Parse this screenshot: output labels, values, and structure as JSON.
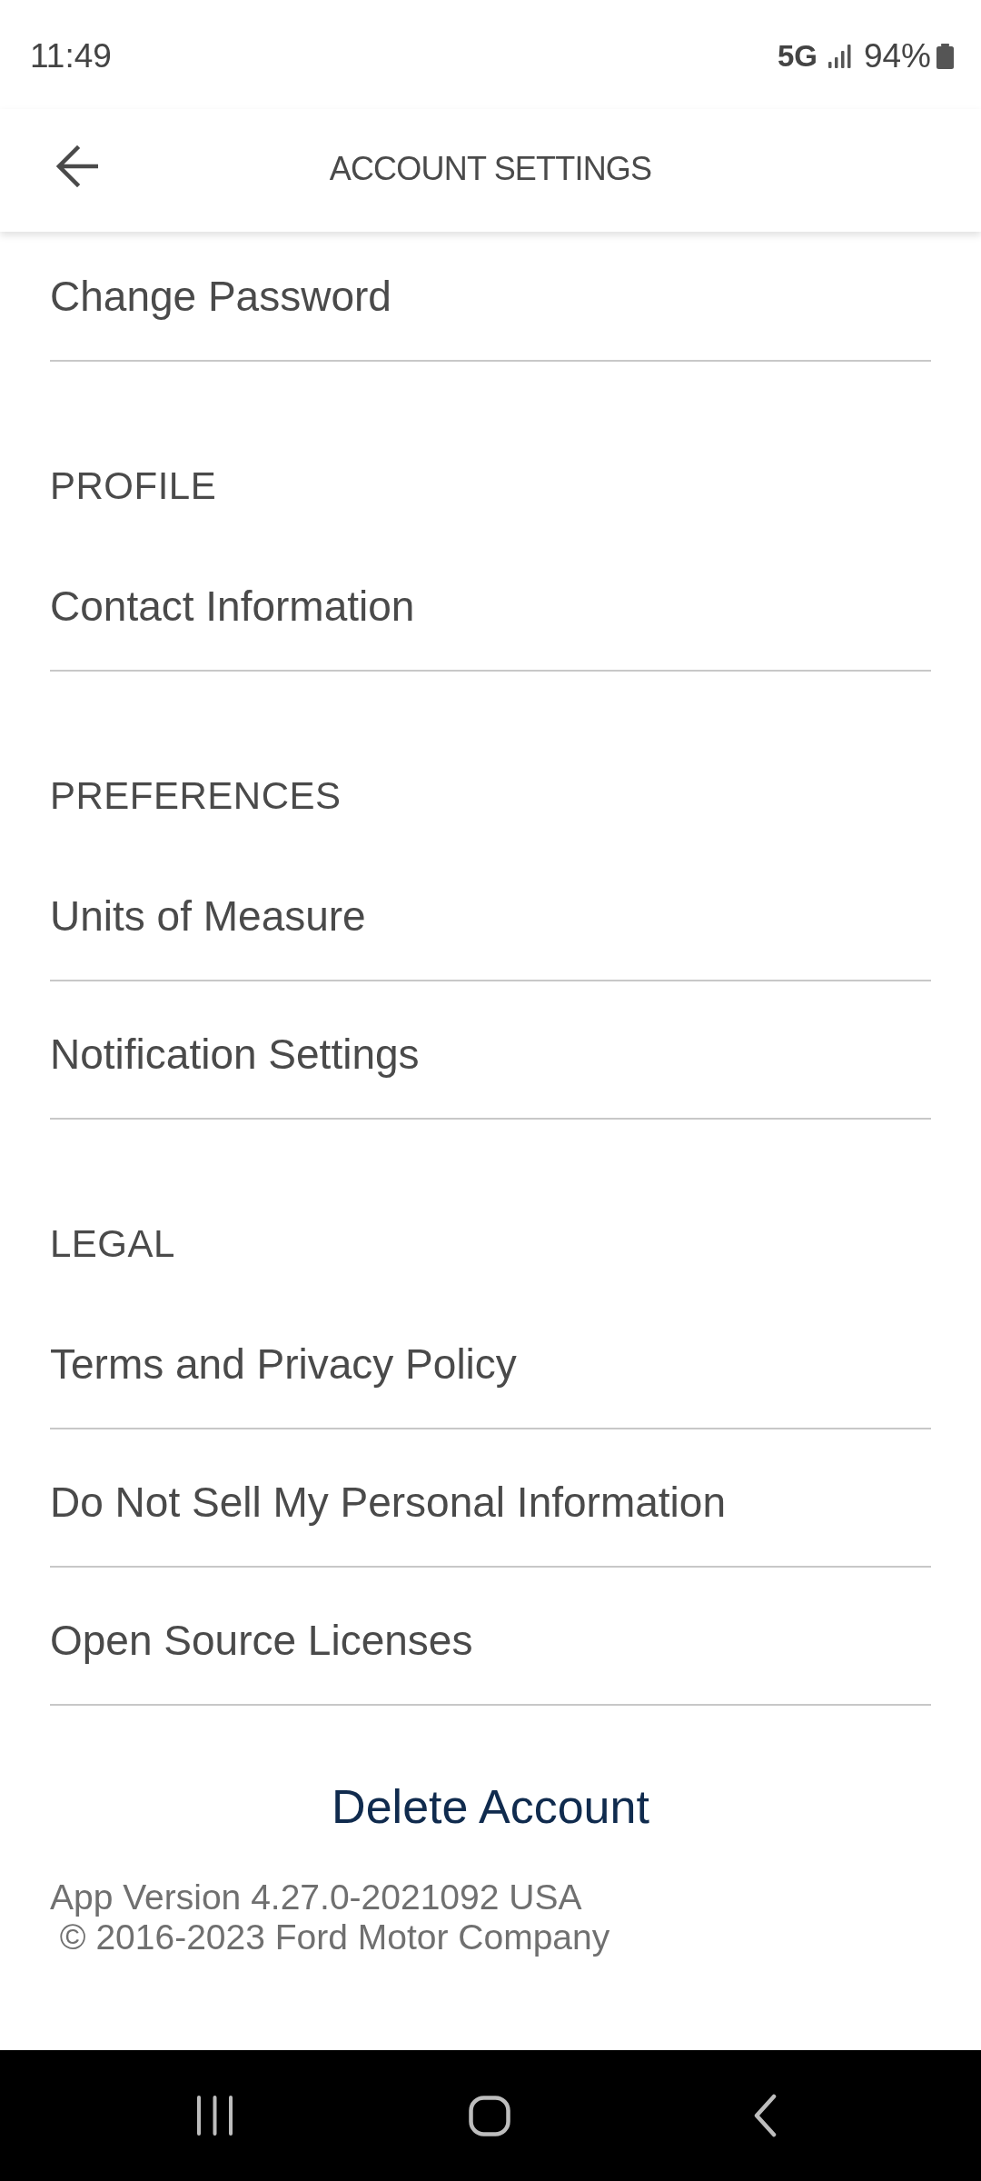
{
  "status_bar": {
    "time": "11:49",
    "network": "5G",
    "battery": "94%"
  },
  "header": {
    "title": "ACCOUNT SETTINGS"
  },
  "sections": [
    {
      "items": [
        {
          "label": "Change Password"
        }
      ]
    },
    {
      "title": "PROFILE",
      "items": [
        {
          "label": "Contact Information"
        }
      ]
    },
    {
      "title": "PREFERENCES",
      "items": [
        {
          "label": "Units of Measure"
        },
        {
          "label": "Notification Settings"
        }
      ]
    },
    {
      "title": "LEGAL",
      "items": [
        {
          "label": "Terms and Privacy Policy"
        },
        {
          "label": "Do Not Sell My Personal Information"
        },
        {
          "label": "Open Source Licenses"
        }
      ]
    }
  ],
  "delete_button": {
    "label": "Delete Account"
  },
  "footer": {
    "app_version": "App Version 4.27.0-2021092 USA",
    "copyright": " © 2016-2023 Ford Motor Company"
  }
}
